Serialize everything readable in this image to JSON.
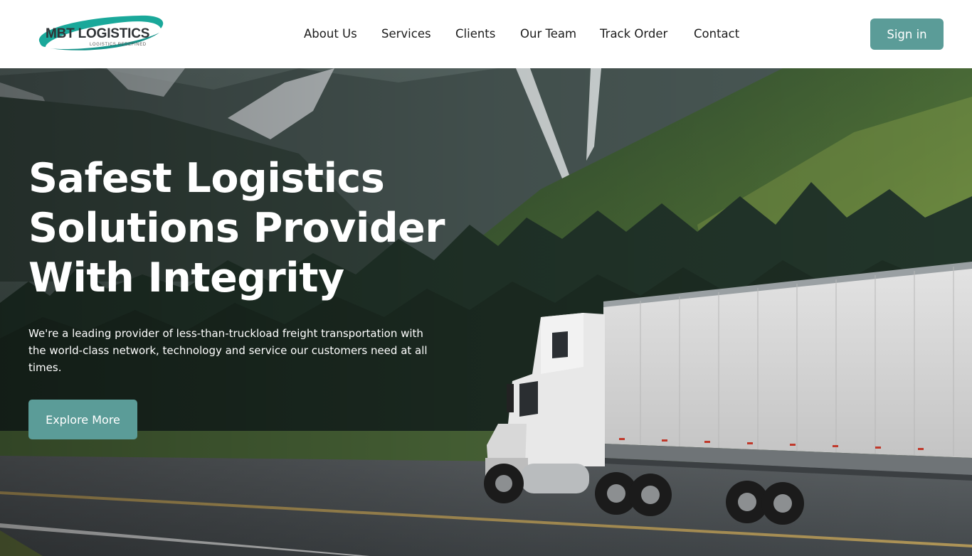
{
  "brand": {
    "name": "MBT LOGISTICS",
    "tagline": "LOGISTICS REDEFINED",
    "accent_color": "#5b9c98",
    "logo_swoosh_color": "#1aa89a"
  },
  "nav": {
    "items": [
      {
        "label": "About Us"
      },
      {
        "label": "Services"
      },
      {
        "label": "Clients"
      },
      {
        "label": "Our Team"
      },
      {
        "label": "Track Order"
      },
      {
        "label": "Contact"
      }
    ],
    "signin_label": "Sign in"
  },
  "hero": {
    "title_line1": "Safest Logistics",
    "title_line2": "Solutions Provider",
    "title_line3": "With Integrity",
    "description": "We're a leading provider of less-than-truckload freight transportation with the world-class network, technology and service our customers need at all times.",
    "cta_label": "Explore More"
  }
}
